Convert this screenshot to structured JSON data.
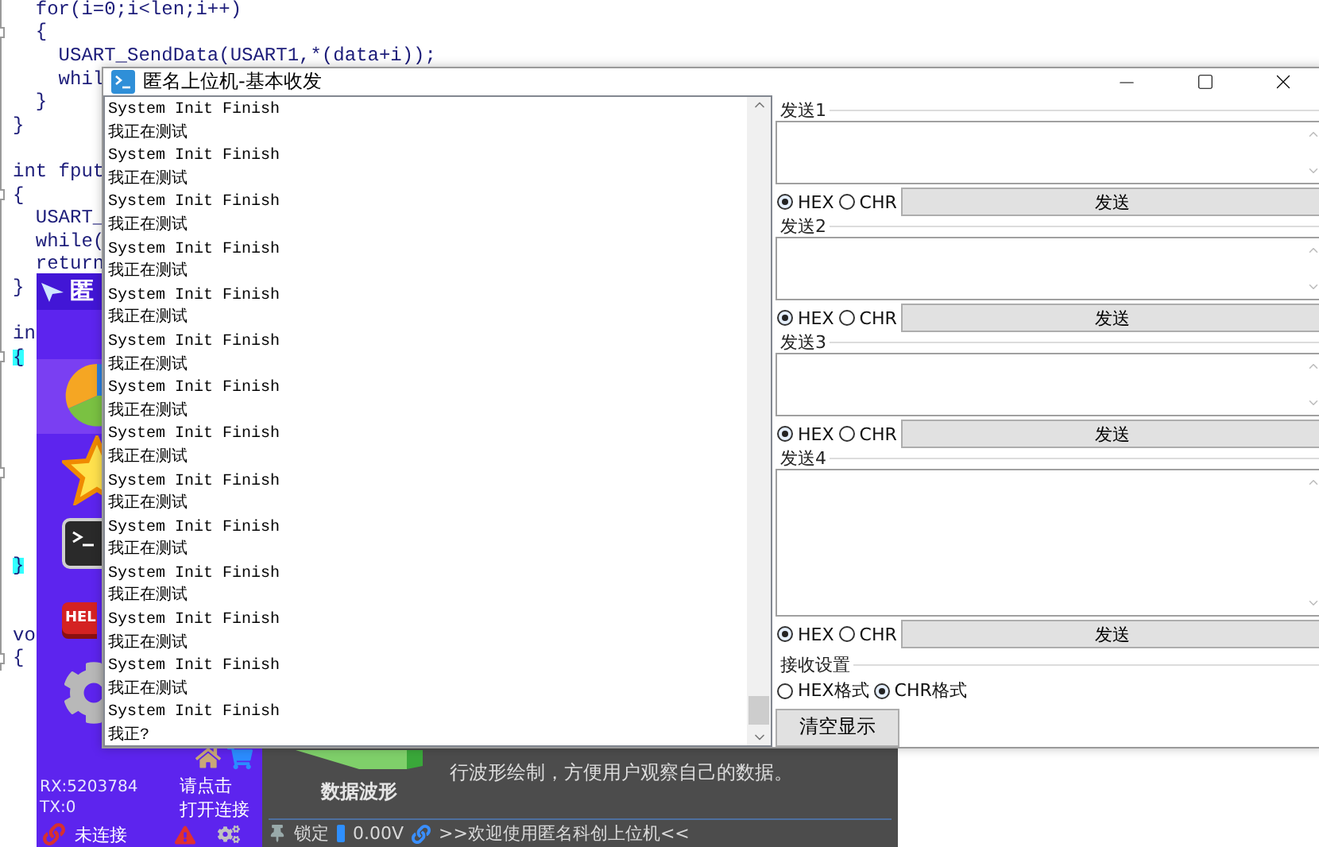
{
  "code_editor": {
    "lines": [
      {
        "kind": "code",
        "text": "  for(i=0;i<len;i++)"
      },
      {
        "kind": "code",
        "text": "  {",
        "fold": true
      },
      {
        "kind": "code",
        "text": "    USART_SendData(USART1,*(data+i));"
      },
      {
        "kind": "code",
        "text": "    whil"
      },
      {
        "kind": "code",
        "text": "  }"
      },
      {
        "kind": "code",
        "text": "}"
      },
      {
        "kind": "blank"
      },
      {
        "kind": "code",
        "text": "int fput"
      },
      {
        "kind": "code",
        "text": "{",
        "fold": true
      },
      {
        "kind": "code",
        "text": "  USART_"
      },
      {
        "kind": "code",
        "text": "  while("
      },
      {
        "kind": "code",
        "text": "  return"
      },
      {
        "kind": "code",
        "text": "}"
      },
      {
        "kind": "blank"
      },
      {
        "kind": "code",
        "text": "in"
      },
      {
        "kind": "code",
        "text": "{",
        "fold": true,
        "highlighted": true
      },
      {
        "kind": "blank"
      },
      {
        "kind": "blank"
      },
      {
        "kind": "blank"
      },
      {
        "kind": "blank"
      },
      {
        "kind": "blank",
        "fold": true
      },
      {
        "kind": "blank"
      },
      {
        "kind": "blank"
      },
      {
        "kind": "blank"
      },
      {
        "kind": "code",
        "text": "}",
        "highlighted": true
      },
      {
        "kind": "blank"
      },
      {
        "kind": "blank"
      },
      {
        "kind": "code",
        "text": "vo"
      },
      {
        "kind": "code",
        "text": "{",
        "fold": true
      }
    ]
  },
  "main_window": {
    "title": "匿",
    "nav_items": [
      {
        "kind": "chart",
        "selected": true
      },
      {
        "kind": "star",
        "selected": false
      },
      {
        "kind": "terminal",
        "selected": false
      },
      {
        "kind": "help",
        "label": "HEL",
        "selected": false
      },
      {
        "kind": "settings",
        "selected": false
      }
    ],
    "rx": "RX:5203784",
    "tx": "TX:0",
    "connect_prompt": [
      "请点击",
      "打开连接"
    ],
    "connection_status": "未连接",
    "feature": {
      "title": "数据波形",
      "description": "行波形绘制，方便用户观察自己的数据。"
    },
    "status_bar": {
      "lock": "锁定",
      "voltage": "0.00V",
      "message": ">>欢迎使用匿名科创上位机<<"
    }
  },
  "serial_window": {
    "title": "匿名上位机-基本收发",
    "log": [
      "System Init Finish",
      "我正在测试",
      "System Init Finish",
      "我正在测试",
      "System Init Finish",
      "我正在测试",
      "System Init Finish",
      "我正在测试",
      "System Init Finish",
      "我正在测试",
      "System Init Finish",
      "我正在测试",
      "System Init Finish",
      "我正在测试",
      "System Init Finish",
      "我正在测试",
      "System Init Finish",
      "我正在测试",
      "System Init Finish",
      "我正在测试",
      "System Init Finish",
      "我正在测试",
      "System Init Finish",
      "我正在测试",
      "System Init Finish",
      "我正在测试",
      "System Init Finish",
      "我正?"
    ],
    "send_groups": [
      {
        "label": "发送1",
        "options": [
          {
            "label": "HEX",
            "selected": true
          },
          {
            "label": "CHR",
            "selected": false
          }
        ],
        "button": "发送"
      },
      {
        "label": "发送2",
        "options": [
          {
            "label": "HEX",
            "selected": true
          },
          {
            "label": "CHR",
            "selected": false
          }
        ],
        "button": "发送"
      },
      {
        "label": "发送3",
        "options": [
          {
            "label": "HEX",
            "selected": true
          },
          {
            "label": "CHR",
            "selected": false
          }
        ],
        "button": "发送"
      },
      {
        "label": "发送4",
        "options": [
          {
            "label": "HEX",
            "selected": true
          },
          {
            "label": "CHR",
            "selected": false
          }
        ],
        "button": "发送"
      }
    ],
    "receive_settings": {
      "label": "接收设置",
      "options": [
        {
          "label": "HEX格式",
          "selected": false
        },
        {
          "label": "CHR格式",
          "selected": true
        }
      ]
    },
    "clear_button": "清空显示"
  }
}
